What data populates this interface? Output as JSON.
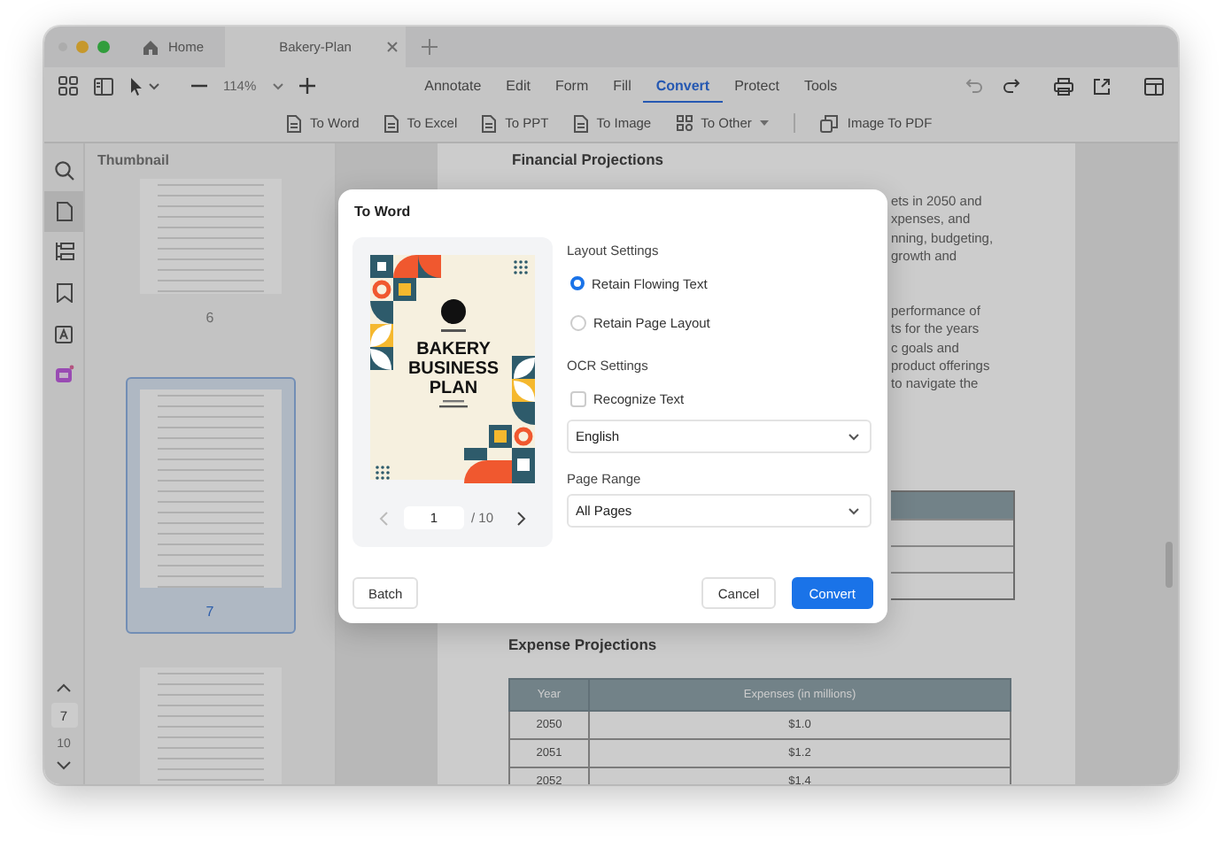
{
  "window": {
    "tabs": [
      {
        "label": "Home",
        "selected": false,
        "kind": "home"
      },
      {
        "label": "Bakery-Plan",
        "selected": true,
        "kind": "document"
      }
    ]
  },
  "toolbar": {
    "zoom": "114%",
    "menu": [
      {
        "label": "Annotate",
        "selected": false
      },
      {
        "label": "Edit",
        "selected": false
      },
      {
        "label": "Form",
        "selected": false
      },
      {
        "label": "Fill",
        "selected": false
      },
      {
        "label": "Convert",
        "selected": true
      },
      {
        "label": "Protect",
        "selected": false
      },
      {
        "label": "Tools",
        "selected": false
      }
    ]
  },
  "convert_bar": [
    {
      "label": "To Word",
      "kind": "document"
    },
    {
      "label": "To Excel",
      "kind": "document"
    },
    {
      "label": "To PPT",
      "kind": "document"
    },
    {
      "label": "To Image",
      "kind": "document"
    },
    {
      "label": "To Other",
      "kind": "other"
    },
    {
      "label": "Image To PDF",
      "kind": "copy"
    }
  ],
  "rail": [
    {
      "kind": "search",
      "selected": false
    },
    {
      "kind": "page",
      "selected": true
    },
    {
      "kind": "outline",
      "selected": false
    },
    {
      "kind": "bookmark",
      "selected": false
    },
    {
      "kind": "textbox",
      "selected": false
    },
    {
      "kind": "ai",
      "selected": false
    }
  ],
  "page_nav": {
    "current": "7",
    "total": "10"
  },
  "sidebar": {
    "title": "Thumbnail",
    "pages": [
      {
        "label": "6",
        "selected": false
      },
      {
        "label": "7",
        "selected": true
      },
      {
        "selected": false
      }
    ]
  },
  "document": {
    "heading": "Financial Projections",
    "paragraph_1": [
      "ets in 2050 and",
      "xpenses, and",
      "nning, budgeting,",
      "growth and"
    ],
    "paragraph_2": [
      "performance of",
      "ts for the years",
      "c goals and",
      "product offerings",
      "to navigate the"
    ],
    "expense_heading": "Expense Projections",
    "expense_table": {
      "columns": [
        "Year",
        "Expenses (in millions)"
      ],
      "rows": [
        [
          "2050",
          "$1.0"
        ],
        [
          "2051",
          "$1.2"
        ],
        [
          "2052",
          "$1.4"
        ]
      ]
    }
  },
  "dialog": {
    "title": "To Word",
    "cover_title": "BAKERY BUSINESS PLAN",
    "page_input": "1",
    "page_total": "/ 10",
    "settings": [
      {
        "kind": "heading",
        "label": "Layout Settings"
      },
      {
        "kind": "radio",
        "label": "Retain Flowing Text",
        "selected": true
      },
      {
        "kind": "radio",
        "label": "Retain Page Layout",
        "selected": false
      },
      {
        "kind": "heading",
        "label": "OCR Settings"
      },
      {
        "kind": "checkbox",
        "label": "Recognize Text",
        "checked": false
      },
      {
        "kind": "select",
        "value": "English"
      },
      {
        "kind": "heading",
        "label": "Page Range"
      },
      {
        "kind": "select",
        "value": "All Pages"
      }
    ],
    "left_button": "Batch",
    "buttons": [
      {
        "label": "Cancel",
        "primary": false
      },
      {
        "label": "Convert",
        "primary": true
      }
    ]
  }
}
